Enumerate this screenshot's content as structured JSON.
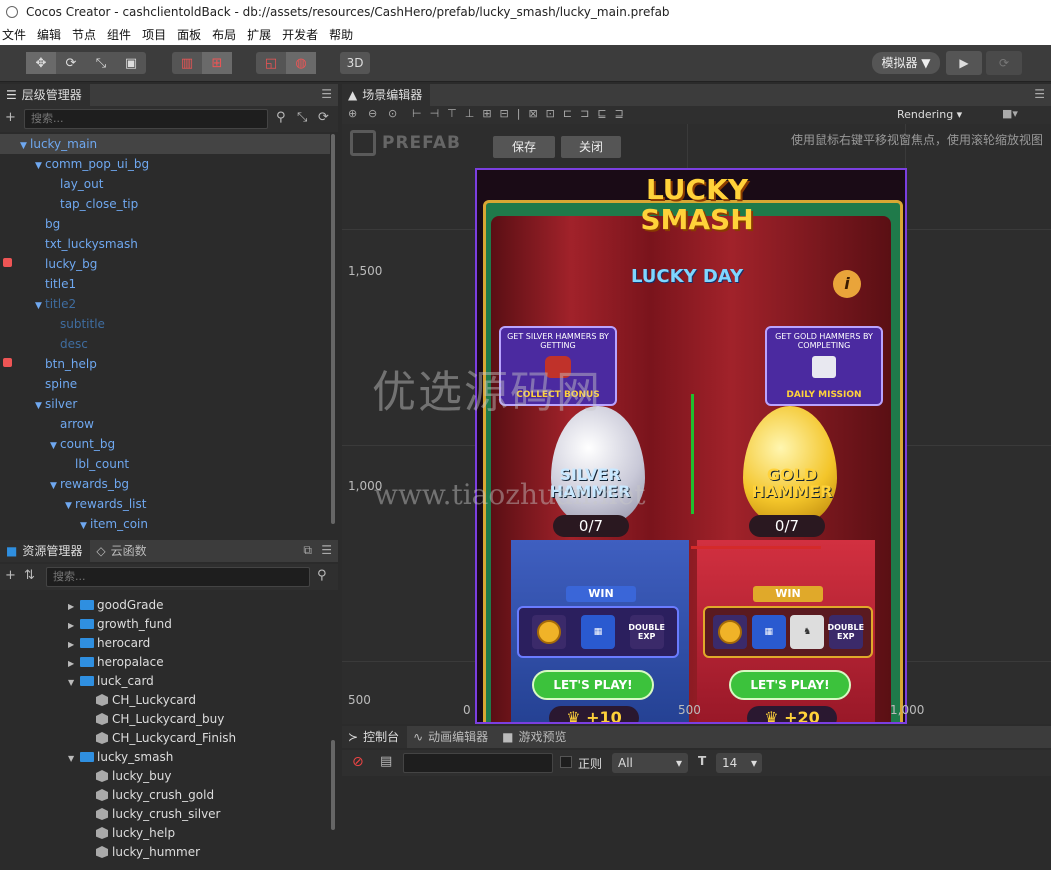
{
  "window": {
    "title": "Cocos Creator - cashclientoldBack - db://assets/resources/CashHero/prefab/lucky_smash/lucky_main.prefab"
  },
  "menu": [
    "文件",
    "编辑",
    "节点",
    "组件",
    "项目",
    "面板",
    "布局",
    "扩展",
    "开发者",
    "帮助"
  ],
  "toolbar": {
    "btn_3d": "3D",
    "simulator": "模拟器 ▼"
  },
  "hierarchy": {
    "tab": "层级管理器",
    "search_placeholder": "搜索...",
    "nodes": [
      {
        "label": "lucky_main",
        "depth": 0,
        "expanded": true,
        "selected": true
      },
      {
        "label": "comm_pop_ui_bg",
        "depth": 1,
        "expanded": true
      },
      {
        "label": "lay_out",
        "depth": 2
      },
      {
        "label": "tap_close_tip",
        "depth": 2
      },
      {
        "label": "bg",
        "depth": 1
      },
      {
        "label": "txt_luckysmash",
        "depth": 1
      },
      {
        "label": "lucky_bg",
        "depth": 1,
        "locked": true
      },
      {
        "label": "title1",
        "depth": 1
      },
      {
        "label": "title2",
        "depth": 1,
        "expanded": true,
        "dim": true
      },
      {
        "label": "subtitle",
        "depth": 2,
        "dim": true
      },
      {
        "label": "desc",
        "depth": 2,
        "dim": true
      },
      {
        "label": "btn_help",
        "depth": 1,
        "locked": true
      },
      {
        "label": "spine",
        "depth": 1
      },
      {
        "label": "silver",
        "depth": 1,
        "expanded": true
      },
      {
        "label": "arrow",
        "depth": 2
      },
      {
        "label": "count_bg",
        "depth": 2,
        "expanded": true
      },
      {
        "label": "lbl_count",
        "depth": 3
      },
      {
        "label": "rewards_bg",
        "depth": 2,
        "expanded": true
      },
      {
        "label": "rewards_list",
        "depth": 3,
        "expanded": true
      },
      {
        "label": "item_coin",
        "depth": 4,
        "expanded": true
      }
    ]
  },
  "assets": {
    "tab": "资源管理器",
    "tab2": "云函数",
    "search_placeholder": "搜索...",
    "items": [
      {
        "label": "goodGrade",
        "type": "folder",
        "depth": 0,
        "arrow": "right"
      },
      {
        "label": "growth_fund",
        "type": "folder",
        "depth": 0,
        "arrow": "right"
      },
      {
        "label": "herocard",
        "type": "folder",
        "depth": 0,
        "arrow": "right"
      },
      {
        "label": "heropalace",
        "type": "folder",
        "depth": 0,
        "arrow": "right"
      },
      {
        "label": "luck_card",
        "type": "folder",
        "depth": 0,
        "arrow": "down"
      },
      {
        "label": "CH_Luckycard",
        "type": "prefab",
        "depth": 1
      },
      {
        "label": "CH_Luckycard_buy",
        "type": "prefab",
        "depth": 1
      },
      {
        "label": "CH_Luckycard_Finish",
        "type": "prefab",
        "depth": 1
      },
      {
        "label": "lucky_smash",
        "type": "folder",
        "depth": 0,
        "arrow": "down"
      },
      {
        "label": "lucky_buy",
        "type": "prefab",
        "depth": 1
      },
      {
        "label": "lucky_crush_gold",
        "type": "prefab",
        "depth": 1
      },
      {
        "label": "lucky_crush_silver",
        "type": "prefab",
        "depth": 1
      },
      {
        "label": "lucky_help",
        "type": "prefab",
        "depth": 1
      },
      {
        "label": "lucky_hummer",
        "type": "prefab",
        "depth": 1
      }
    ]
  },
  "scene": {
    "tab": "场景编辑器",
    "render_mode": "Rendering",
    "prefab_label": "PREFAB",
    "save": "保存",
    "close": "关闭",
    "hint": "使用鼠标右键平移视窗焦点，使用滚轮缩放视图",
    "axis_y": [
      "1,500",
      "1,000",
      "500"
    ],
    "axis_x": [
      "0",
      "500",
      "1,000"
    ]
  },
  "game": {
    "title": "LUCKY SMASH",
    "subtitle": "LUCKY DAY",
    "info": "i",
    "left_bubble": {
      "text": "GET SILVER HAMMERS BY GETTING",
      "action": "COLLECT BONUS"
    },
    "right_bubble": {
      "text": "GET GOLD HAMMERS BY COMPLETING",
      "action": "DAILY MISSION"
    },
    "silver": {
      "name": "SILVER HAMMER",
      "count": "0/7",
      "win": "WIN",
      "exp": "DOUBLE EXP",
      "play": "LET'S PLAY!",
      "bonus": "+10"
    },
    "gold": {
      "name": "GOLD HAMMER",
      "count": "0/7",
      "win": "WIN",
      "exp": "DOUBLE EXP",
      "play": "LET'S PLAY!",
      "bonus": "+20"
    },
    "watermark1": "优选源码网",
    "watermark2": "www.tiaozhuan.net"
  },
  "console": {
    "tabs": [
      "控制台",
      "动画编辑器",
      "游戏预览"
    ],
    "regex": "正则",
    "level": "All",
    "font_size": "14"
  },
  "colors": {
    "node_blue": "#6fa8f0",
    "accent_purple": "#7b3fe0",
    "gold": "#ffd23a"
  }
}
